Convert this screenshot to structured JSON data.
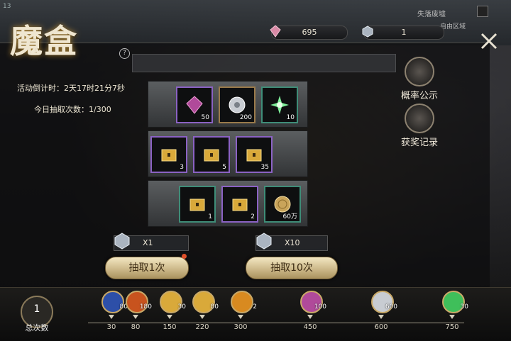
{
  "window": {
    "title": "魔盒",
    "corner_number": "13",
    "map_name": "失落废墟",
    "map_zone": "自由区域",
    "map_center": "集结"
  },
  "currency": [
    {
      "icon": "pink-crystal-icon",
      "value": "695"
    },
    {
      "icon": "silver-cube-icon",
      "value": "1"
    }
  ],
  "info": {
    "countdown": "活动倒计时：2天17时21分7秒",
    "daily_draws": "今日抽取次数：1/300"
  },
  "side_buttons": {
    "rate_label": "概率公示",
    "record_label": "获奖记录"
  },
  "cube_rows": [
    [
      {
        "icon": "purple-pink-gem-icon",
        "count": "50",
        "frame": "p"
      },
      {
        "icon": "silver-cylinder-icon",
        "count": "200",
        "frame": "g"
      },
      {
        "icon": "green-burst-icon",
        "count": "10",
        "frame": "t"
      }
    ],
    [
      {
        "icon": "gold-chest-icon",
        "count": "3",
        "frame": "p"
      },
      {
        "icon": "gold-chest-icon",
        "count": "5",
        "frame": "p"
      },
      {
        "icon": "gold-chest-icon",
        "count": "35",
        "frame": "p"
      }
    ],
    [
      {
        "icon": "gold-chest-icon",
        "count": "1",
        "frame": "t"
      },
      {
        "icon": "gold-chest-icon",
        "count": "2",
        "frame": "p"
      },
      {
        "icon": "gold-coin-icon",
        "count": "60万",
        "frame": "t"
      }
    ]
  ],
  "pulls": {
    "single_cost": "X1",
    "ten_cost": "X10",
    "single_label": "抽取1次",
    "ten_label": "抽取10次"
  },
  "progress": {
    "total_count": "1",
    "total_label": "总次数",
    "milestones": [
      {
        "threshold": "30",
        "count": "80",
        "icon": "blue-cube-icon"
      },
      {
        "threshold": "80",
        "count": "180",
        "icon": "fire-orb-icon"
      },
      {
        "threshold": "150",
        "count": "30",
        "icon": "gold-chest-icon"
      },
      {
        "threshold": "220",
        "count": "80",
        "icon": "gold-chest-icon"
      },
      {
        "threshold": "300",
        "count": "2",
        "icon": "amber-gem-icon"
      },
      {
        "threshold": "450",
        "count": "100",
        "icon": "purple-pink-gem-icon"
      },
      {
        "threshold": "600",
        "count": "600",
        "icon": "silver-cylinder-icon"
      },
      {
        "threshold": "750",
        "count": "30",
        "icon": "green-burst-icon"
      }
    ]
  },
  "colors": {
    "accent_gold": "#cdb98a",
    "frame_purple": "#8b62c4",
    "frame_teal": "#3f8d78"
  }
}
